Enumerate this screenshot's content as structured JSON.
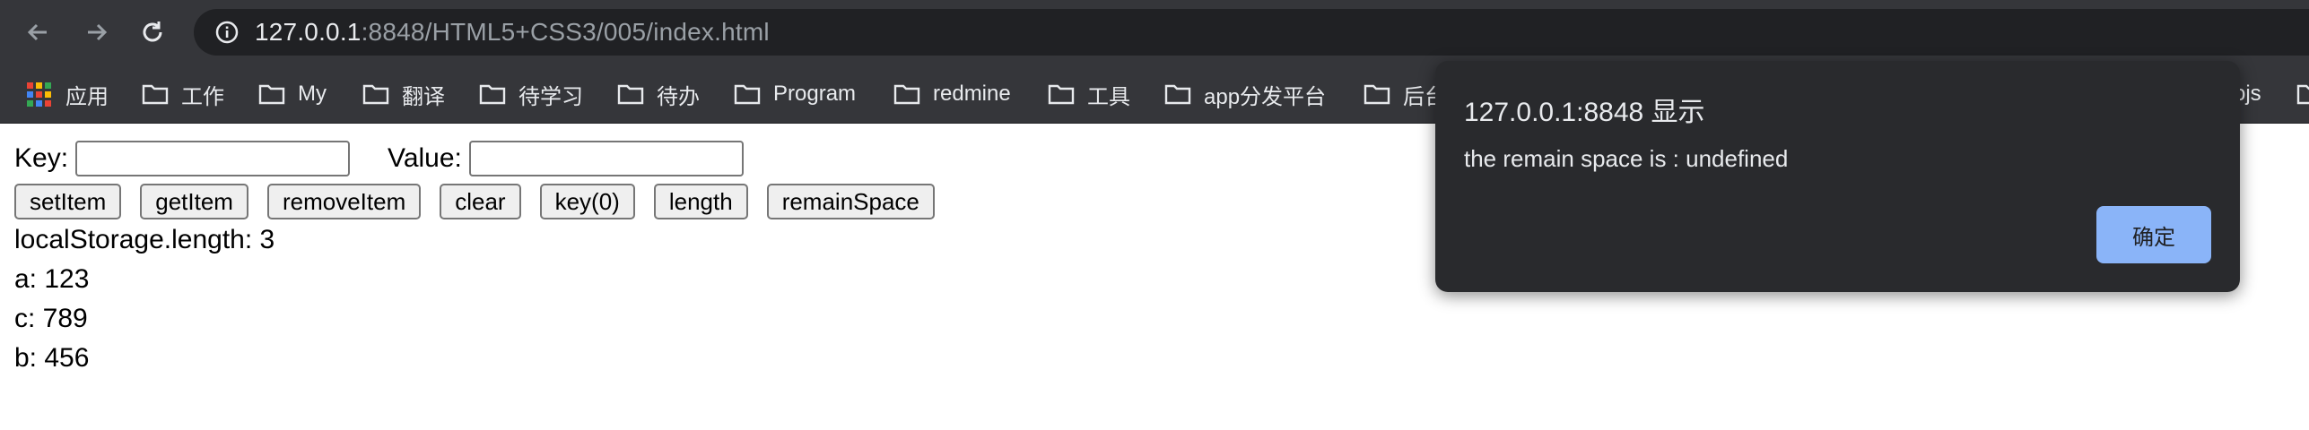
{
  "browser": {
    "url_host": "127.0.0.1",
    "url_rest": ":8848/HTML5+CSS3/005/index.html",
    "bookmarks": [
      "应用",
      "工作",
      "My",
      "翻译",
      "待学习",
      "待办",
      "Program",
      "redmine",
      "工具",
      "app分发平台",
      "后台",
      "ojs"
    ]
  },
  "form": {
    "key_label": "Key:",
    "value_label": "Value:",
    "key_value": "",
    "value_value": ""
  },
  "buttons": [
    "setItem",
    "getItem",
    "removeItem",
    "clear",
    "key(0)",
    "length",
    "remainSpace"
  ],
  "output": {
    "length_line": "localStorage.length: 3",
    "items": [
      "a: 123",
      "c: 789",
      "b: 456"
    ]
  },
  "dialog": {
    "title": "127.0.0.1:8848 显示",
    "message": "the remain space is : undefined",
    "ok_label": "确定"
  },
  "colors": {
    "chrome_bg": "#35363a",
    "omnibox_bg": "#202124",
    "dialog_bg": "#292a2d",
    "dialog_button": "#8ab4f8"
  }
}
